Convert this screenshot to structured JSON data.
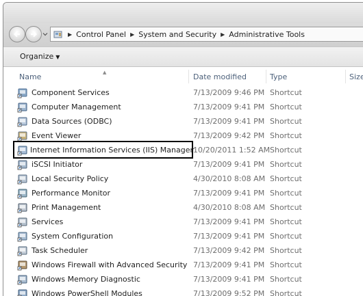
{
  "address": {
    "crumbs": [
      "Control Panel",
      "System and Security",
      "Administrative Tools"
    ],
    "folder_icon": "control-panel-icon"
  },
  "toolbar": {
    "organize_label": "Organize"
  },
  "columns": {
    "name": "Name",
    "date": "Date modified",
    "type": "Type",
    "size": "Size"
  },
  "items": [
    {
      "name": "Component Services",
      "date": "7/13/2009 9:46 PM",
      "type": "Shortcut",
      "icon": "component-services-icon"
    },
    {
      "name": "Computer Management",
      "date": "7/13/2009 9:41 PM",
      "type": "Shortcut",
      "icon": "computer-management-icon"
    },
    {
      "name": "Data Sources (ODBC)",
      "date": "7/13/2009 9:41 PM",
      "type": "Shortcut",
      "icon": "data-sources-icon"
    },
    {
      "name": "Event Viewer",
      "date": "7/13/2009 9:42 PM",
      "type": "Shortcut",
      "icon": "event-viewer-icon"
    },
    {
      "name": "Internet Information Services (IIS) Manager",
      "date": "10/20/2011 1:52 AM",
      "type": "Shortcut",
      "icon": "iis-manager-icon",
      "highlighted": true
    },
    {
      "name": "iSCSI Initiator",
      "date": "7/13/2009 9:41 PM",
      "type": "Shortcut",
      "icon": "iscsi-initiator-icon"
    },
    {
      "name": "Local Security Policy",
      "date": "4/30/2010 8:08 AM",
      "type": "Shortcut",
      "icon": "local-security-policy-icon"
    },
    {
      "name": "Performance Monitor",
      "date": "7/13/2009 9:41 PM",
      "type": "Shortcut",
      "icon": "performance-monitor-icon"
    },
    {
      "name": "Print Management",
      "date": "4/30/2010 8:08 AM",
      "type": "Shortcut",
      "icon": "print-management-icon"
    },
    {
      "name": "Services",
      "date": "7/13/2009 9:41 PM",
      "type": "Shortcut",
      "icon": "services-icon"
    },
    {
      "name": "System Configuration",
      "date": "7/13/2009 9:41 PM",
      "type": "Shortcut",
      "icon": "system-configuration-icon"
    },
    {
      "name": "Task Scheduler",
      "date": "7/13/2009 9:42 PM",
      "type": "Shortcut",
      "icon": "task-scheduler-icon"
    },
    {
      "name": "Windows Firewall with Advanced Security",
      "date": "7/13/2009 9:41 PM",
      "type": "Shortcut",
      "icon": "windows-firewall-icon"
    },
    {
      "name": "Windows Memory Diagnostic",
      "date": "7/13/2009 9:41 PM",
      "type": "Shortcut",
      "icon": "memory-diagnostic-icon"
    },
    {
      "name": "Windows PowerShell Modules",
      "date": "7/13/2009 9:52 PM",
      "type": "Shortcut",
      "icon": "powershell-modules-icon"
    }
  ]
}
